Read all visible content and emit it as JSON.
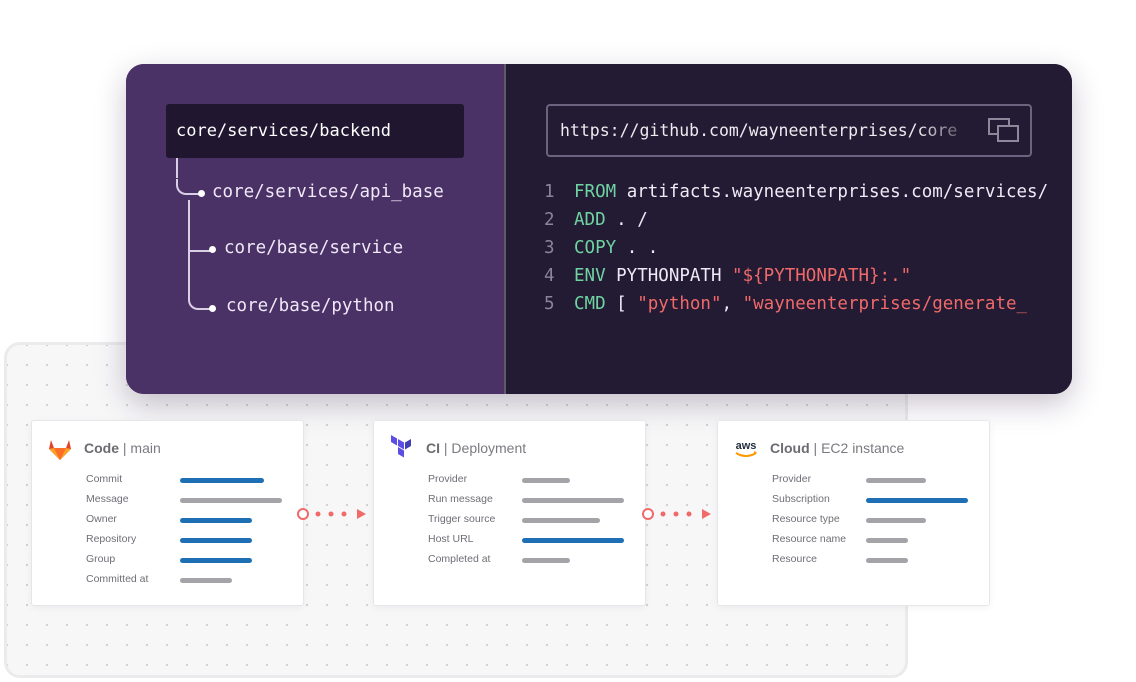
{
  "tree": {
    "root": "core/services/backend",
    "children": [
      "core/services/api_base",
      "core/base/service",
      "core/base/python"
    ]
  },
  "code": {
    "url": "https://github.com/wayneenterprises/core",
    "lines": [
      {
        "num": "1",
        "parts": [
          {
            "t": "FROM",
            "c": "kw"
          },
          {
            "t": " artifacts.wayneenterprises.com/services/",
            "c": "tx"
          }
        ]
      },
      {
        "num": "2",
        "parts": [
          {
            "t": "ADD",
            "c": "kw"
          },
          {
            "t": " . /",
            "c": "tx"
          }
        ]
      },
      {
        "num": "3",
        "parts": [
          {
            "t": "COPY",
            "c": "kw"
          },
          {
            "t": " . .",
            "c": "tx"
          }
        ]
      },
      {
        "num": "4",
        "parts": [
          {
            "t": "ENV",
            "c": "kw"
          },
          {
            "t": " PYTHONPATH ",
            "c": "tx"
          },
          {
            "t": "\"${PYTHONPATH}:.\"",
            "c": "st"
          }
        ]
      },
      {
        "num": "5",
        "parts": [
          {
            "t": "CMD",
            "c": "kw"
          },
          {
            "t": " [ ",
            "c": "tx"
          },
          {
            "t": "\"python\"",
            "c": "st"
          },
          {
            "t": ", ",
            "c": "tx"
          },
          {
            "t": "\"wayneenterprises/generate_",
            "c": "st"
          }
        ]
      }
    ]
  },
  "cards": [
    {
      "title": "Code",
      "subtitle": " | main",
      "icon": "gitlab-icon",
      "rows": [
        {
          "label": "Commit",
          "fill": 0.42,
          "color": "blue"
        },
        {
          "label": "Message",
          "fill": 0.51,
          "color": "gray"
        },
        {
          "label": "Owner",
          "fill": 0.36,
          "color": "blue"
        },
        {
          "label": "Repository",
          "fill": 0.36,
          "color": "blue"
        },
        {
          "label": "Group",
          "fill": 0.36,
          "color": "blue"
        },
        {
          "label": "Committed at",
          "fill": 0.26,
          "color": "gray"
        }
      ]
    },
    {
      "title": "CI",
      "subtitle": " | Deployment",
      "icon": "terraform-icon",
      "rows": [
        {
          "label": "Provider",
          "fill": 0.24,
          "color": "gray"
        },
        {
          "label": "Run message",
          "fill": 0.51,
          "color": "gray"
        },
        {
          "label": "Trigger source",
          "fill": 0.39,
          "color": "gray"
        },
        {
          "label": "Host URL",
          "fill": 0.51,
          "color": "blue"
        },
        {
          "label": "Completed at",
          "fill": 0.24,
          "color": "gray"
        }
      ]
    },
    {
      "title": "Cloud",
      "subtitle": " | EC2 instance",
      "icon": "aws-icon",
      "rows": [
        {
          "label": "Provider",
          "fill": 0.3,
          "color": "gray"
        },
        {
          "label": "Subscription",
          "fill": 0.51,
          "color": "blue"
        },
        {
          "label": "Resource type",
          "fill": 0.3,
          "color": "gray"
        },
        {
          "label": "Resource name",
          "fill": 0.21,
          "color": "gray"
        },
        {
          "label": "Resource",
          "fill": 0.21,
          "color": "gray"
        }
      ]
    }
  ],
  "colors": {
    "accent": "#f06a6a",
    "blue": "#1f6fb5",
    "panel": "#4a3166"
  }
}
